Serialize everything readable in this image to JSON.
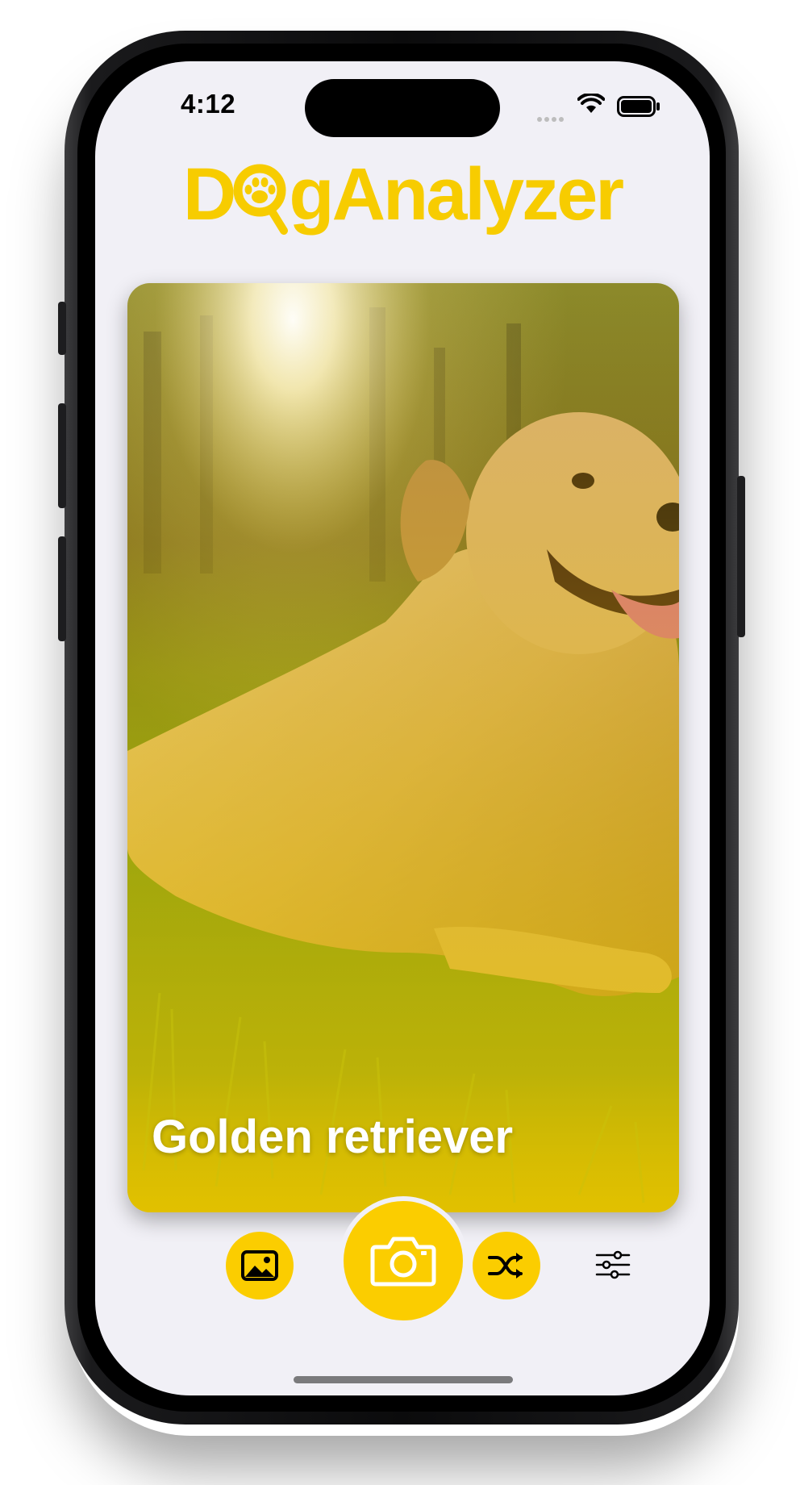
{
  "status_bar": {
    "time": "4:12"
  },
  "app": {
    "logo_text_before": "D",
    "logo_text_after": "gAnalyzer"
  },
  "result": {
    "breed": "Golden retriever"
  },
  "toolbar": {
    "gallery_icon": "photo-icon",
    "camera_icon": "camera-icon",
    "shuffle_icon": "shuffle-icon",
    "settings_icon": "sliders-icon"
  },
  "colors": {
    "accent": "#fbcd00",
    "background": "#f1f0f6"
  }
}
